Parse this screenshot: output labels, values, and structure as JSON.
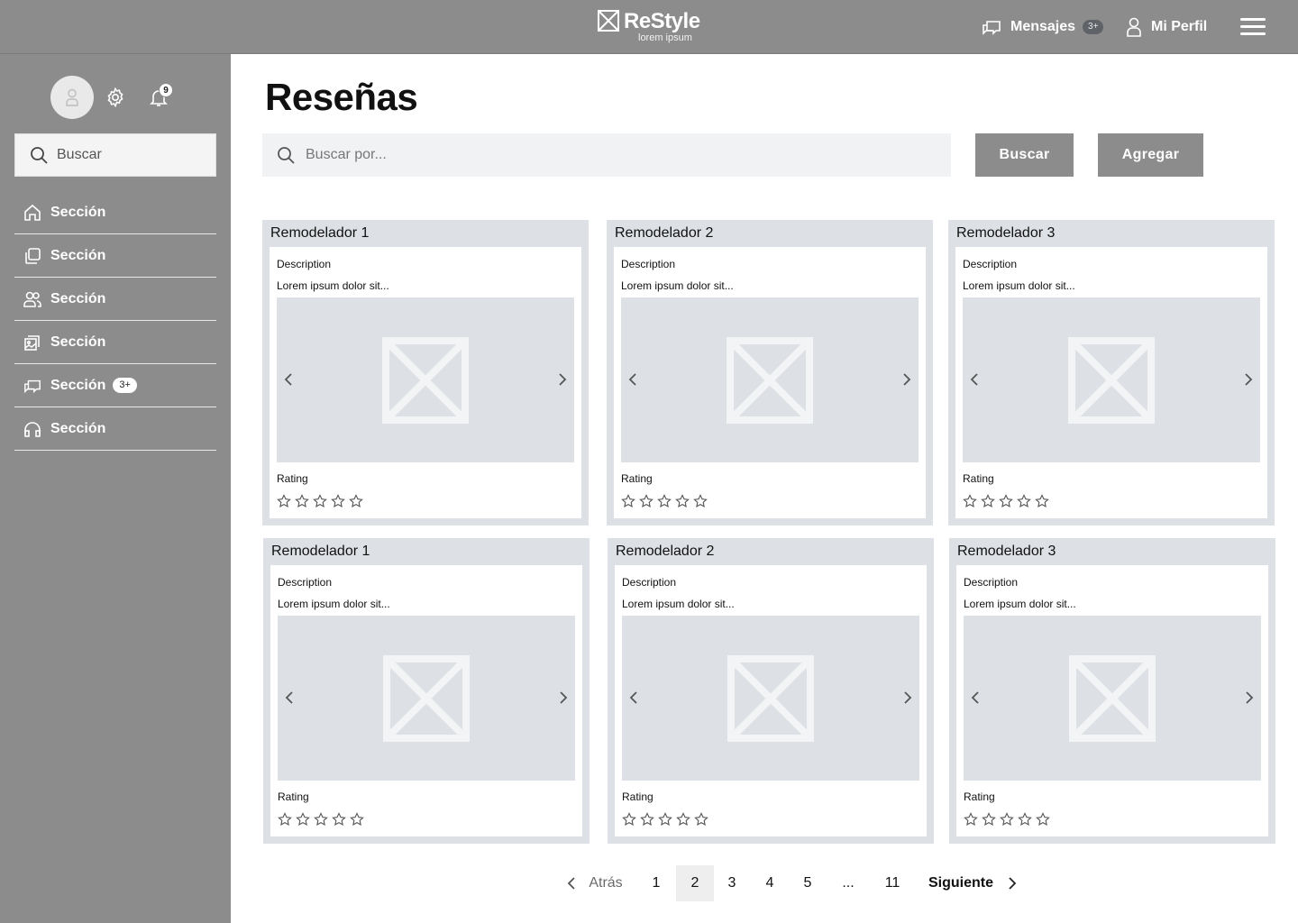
{
  "header": {
    "brand_name": "ReStyle",
    "brand_tagline": "lorem ipsum",
    "messages_label": "Mensajes",
    "messages_badge": "3+",
    "profile_label": "Mi Perfil"
  },
  "sidebar": {
    "notifications_count": "9",
    "search_placeholder": "Buscar",
    "items": [
      {
        "label": "Sección",
        "icon": "home-icon"
      },
      {
        "label": "Sección",
        "icon": "copy-icon"
      },
      {
        "label": "Sección",
        "icon": "users-icon"
      },
      {
        "label": "Sección",
        "icon": "gallery-icon"
      },
      {
        "label": "Sección",
        "icon": "chat-icon",
        "badge": "3+"
      },
      {
        "label": "Sección",
        "icon": "headphones-icon"
      }
    ]
  },
  "main": {
    "title": "Reseñas",
    "search_placeholder": "Buscar por...",
    "search_button": "Buscar",
    "add_button": "Agregar"
  },
  "cards": [
    {
      "title": "Remodelador 1",
      "description_label": "Description",
      "description": "Lorem ipsum dolor sit...",
      "rating_label": "Rating",
      "stars_max": 5,
      "rating": 0
    },
    {
      "title": "Remodelador 2",
      "description_label": "Description",
      "description": "Lorem ipsum dolor sit...",
      "rating_label": "Rating",
      "stars_max": 5,
      "rating": 0
    },
    {
      "title": "Remodelador 3",
      "description_label": "Description",
      "description": "Lorem ipsum dolor sit...",
      "rating_label": "Rating",
      "stars_max": 5,
      "rating": 0
    },
    {
      "title": "Remodelador 1",
      "description_label": "Description",
      "description": "Lorem ipsum dolor sit...",
      "rating_label": "Rating",
      "stars_max": 5,
      "rating": 0
    },
    {
      "title": "Remodelador 2",
      "description_label": "Description",
      "description": "Lorem ipsum dolor sit...",
      "rating_label": "Rating",
      "stars_max": 5,
      "rating": 0
    },
    {
      "title": "Remodelador 3",
      "description_label": "Description",
      "description": "Lorem ipsum dolor sit...",
      "rating_label": "Rating",
      "stars_max": 5,
      "rating": 0
    }
  ],
  "pagination": {
    "prev_label": "Atrás",
    "next_label": "Siguiente",
    "pages": [
      "1",
      "2",
      "3",
      "4",
      "5",
      "...",
      "11"
    ],
    "current": "2"
  },
  "colors": {
    "chrome": "#8c8c8c",
    "card_bg": "#dde0e4",
    "search_bg": "#f1f2f4"
  }
}
